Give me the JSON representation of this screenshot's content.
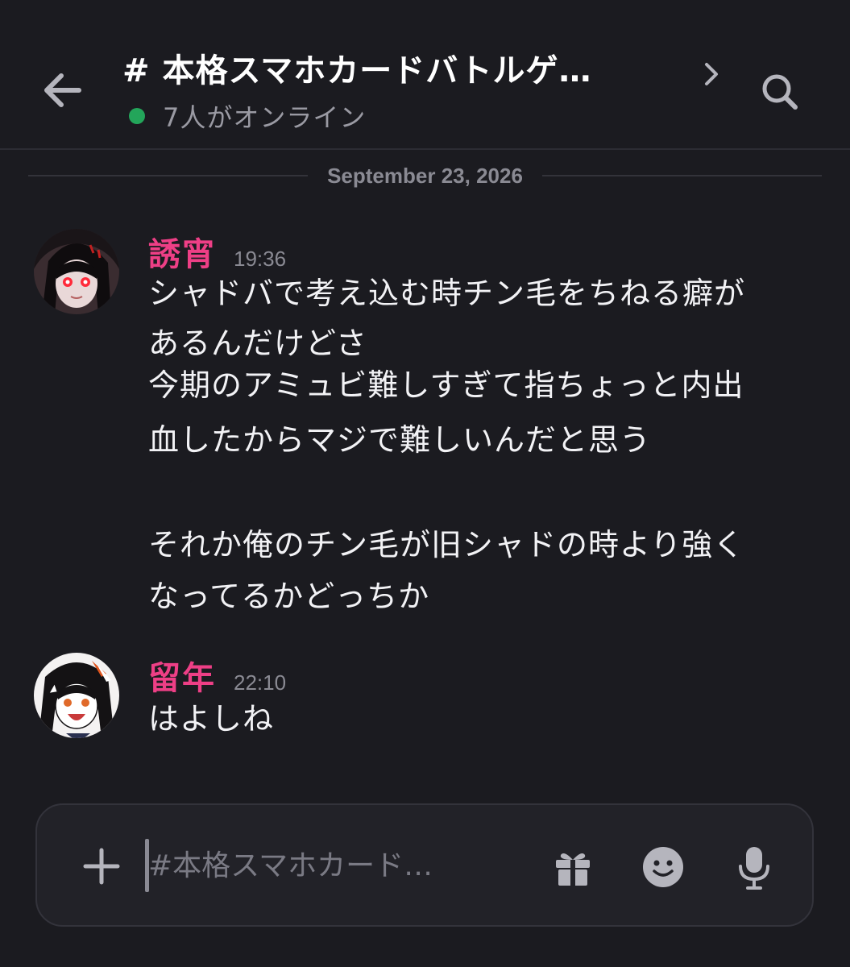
{
  "colors": {
    "background": "#1b1b20",
    "username": "#ee3f86",
    "online": "#23a55a",
    "icon": "#b5b5bd"
  },
  "header": {
    "back_icon": "arrow-left-icon",
    "channel_title": "# 本格スマホカードバトルゲ…",
    "chevron_icon": "chevron-right-icon",
    "online_text": "7人がオンライン",
    "search_icon": "search-icon"
  },
  "date_divider": "September 23, 2026",
  "messages": [
    {
      "username": "誘宵",
      "time": "19:36",
      "lines": [
        "シャドバで考え込む時チン毛をちねる癖が",
        "あるんだけどさ",
        "今期のアミュビ難しすぎて指ちょっと内出",
        "血したからマジで難しいんだと思う",
        "",
        "それか俺のチン毛が旧シャドの時より強く",
        "なってるかどっちか"
      ]
    },
    {
      "username": "留年",
      "time": "22:10",
      "lines": [
        "はよしね"
      ]
    }
  ],
  "composer": {
    "plus_icon": "plus-icon",
    "placeholder": "#本格スマホカード…",
    "gift_icon": "gift-icon",
    "emoji_icon": "emoji-icon",
    "mic_icon": "microphone-icon"
  }
}
